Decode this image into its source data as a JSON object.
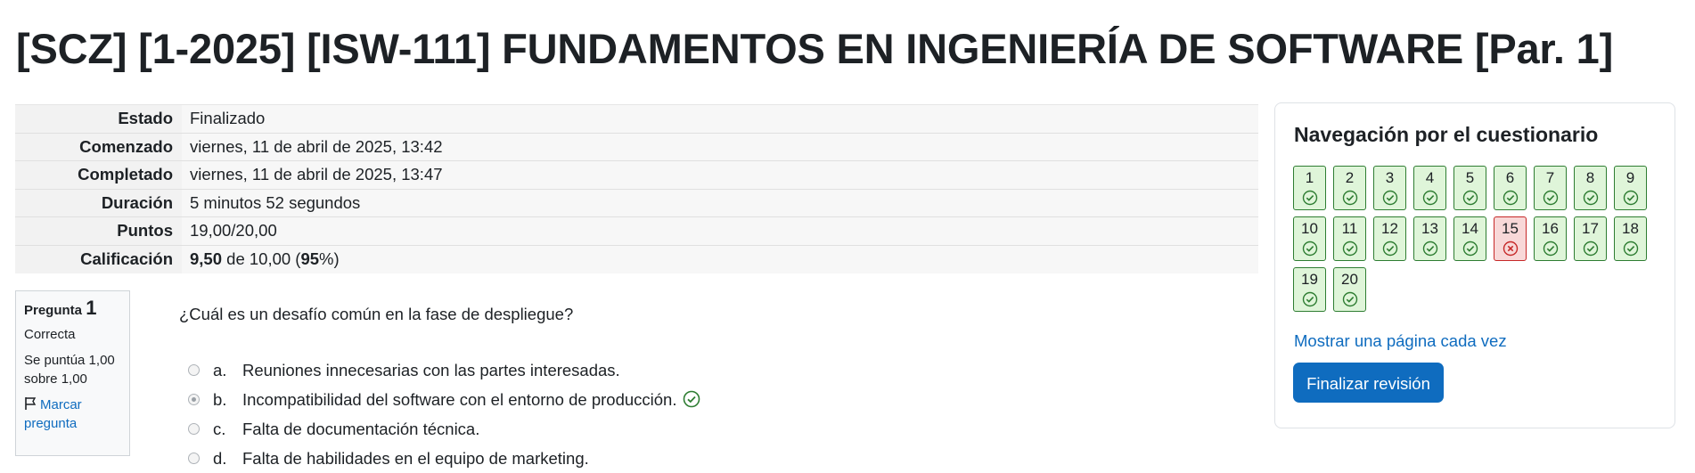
{
  "page_title": "[SCZ] [1-2025] [ISW-111] FUNDAMENTOS EN INGENIERÍA DE SOFTWARE [Par. 1]",
  "summary": [
    {
      "label": "Estado",
      "value": "Finalizado"
    },
    {
      "label": "Comenzado",
      "value": "viernes, 11 de abril de 2025, 13:42"
    },
    {
      "label": "Completado",
      "value": "viernes, 11 de abril de 2025, 13:47"
    },
    {
      "label": "Duración",
      "value": "5 minutos 52 segundos"
    },
    {
      "label": "Puntos",
      "value": "19,00/20,00"
    }
  ],
  "grade": {
    "label": "Calificación",
    "score": "9,50",
    "middle": " de 10,00 (",
    "percent": "95",
    "suffix": "%)"
  },
  "question_info": {
    "prefix": "Pregunta",
    "number": "1",
    "state": "Correcta",
    "grade_line1": "Se puntúa 1,00",
    "grade_line2": "sobre 1,00",
    "flag_line1": "Marcar",
    "flag_line2": "pregunta"
  },
  "question": {
    "text": "¿Cuál es un desafío común en la fase de despliegue?",
    "answers": [
      {
        "letter": "a.",
        "text": "Reuniones innecesarias con las partes interesadas.",
        "selected": false,
        "correct_mark": false
      },
      {
        "letter": "b.",
        "text": "Incompatibilidad del software con el entorno de producción.",
        "selected": true,
        "correct_mark": true
      },
      {
        "letter": "c.",
        "text": "Falta de documentación técnica.",
        "selected": false,
        "correct_mark": false
      },
      {
        "letter": "d.",
        "text": "Falta de habilidades en el equipo de marketing.",
        "selected": false,
        "correct_mark": false
      }
    ]
  },
  "navigation": {
    "title": "Navegación por el cuestionario",
    "questions": [
      {
        "n": "1",
        "status": "correct"
      },
      {
        "n": "2",
        "status": "correct"
      },
      {
        "n": "3",
        "status": "correct"
      },
      {
        "n": "4",
        "status": "correct"
      },
      {
        "n": "5",
        "status": "correct"
      },
      {
        "n": "6",
        "status": "correct"
      },
      {
        "n": "7",
        "status": "correct"
      },
      {
        "n": "8",
        "status": "correct"
      },
      {
        "n": "9",
        "status": "correct"
      },
      {
        "n": "10",
        "status": "correct"
      },
      {
        "n": "11",
        "status": "correct"
      },
      {
        "n": "12",
        "status": "correct"
      },
      {
        "n": "13",
        "status": "correct"
      },
      {
        "n": "14",
        "status": "correct"
      },
      {
        "n": "15",
        "status": "incorrect"
      },
      {
        "n": "16",
        "status": "correct"
      },
      {
        "n": "17",
        "status": "correct"
      },
      {
        "n": "18",
        "status": "correct"
      },
      {
        "n": "19",
        "status": "correct"
      },
      {
        "n": "20",
        "status": "correct"
      }
    ],
    "show_one_page": "Mostrar una página cada vez",
    "finish_button": "Finalizar revisión"
  },
  "colors": {
    "correct_bg": "#dff5d9",
    "correct_border": "#2e7d32",
    "incorrect_bg": "#f8d8d8",
    "incorrect_border": "#c62828",
    "link": "#0f6cbf"
  }
}
